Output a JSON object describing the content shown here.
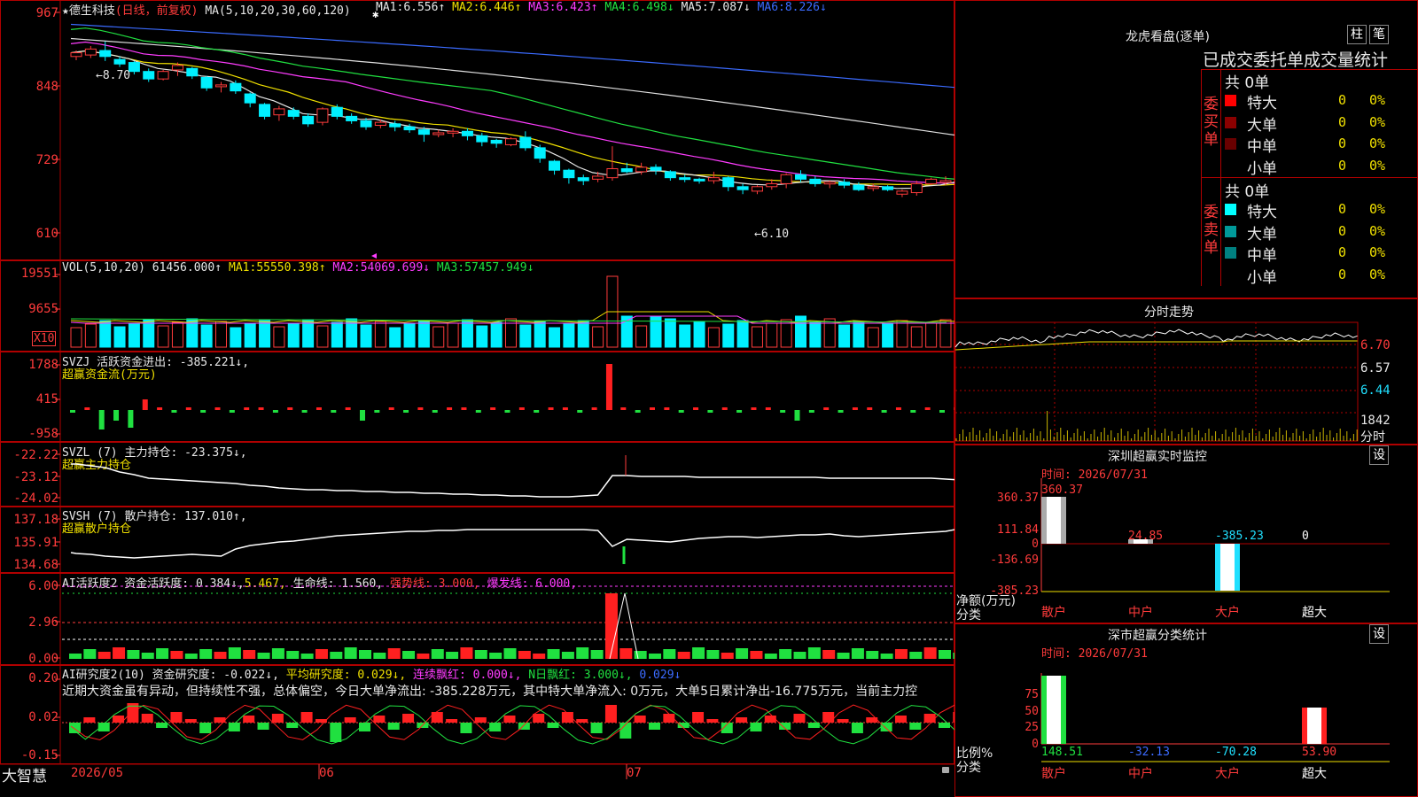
{
  "main": {
    "title": "★德生科技",
    "mode": "(日线，前复权)",
    "ma_header": "MA(5,10,20,30,60,120)",
    "ma": [
      {
        "label": "MA1:",
        "value": "6.556↑",
        "color": "#e8e8e8"
      },
      {
        "label": "MA2:",
        "value": "6.446↑",
        "color": "#f0e000"
      },
      {
        "label": "MA3:",
        "value": "6.423↑",
        "color": "#ff3cff"
      },
      {
        "label": "MA4:",
        "value": "6.498↓",
        "color": "#20e040"
      },
      {
        "label": "MA5:",
        "value": "7.087↓",
        "color": "#e8e8e8"
      },
      {
        "label": "MA6:",
        "value": "8.226↓",
        "color": "#3b6bff"
      }
    ],
    "y_ticks": [
      "967",
      "848",
      "729",
      "610"
    ],
    "high_mark": "8.70",
    "low_mark": "6.10"
  },
  "vol": {
    "header": "VOL(5,10,20)",
    "value": "61456.000↑",
    "ma": [
      {
        "label": "MA1:",
        "value": "55550.398↑",
        "color": "#f0e000"
      },
      {
        "label": "MA2:",
        "value": "54069.699↓",
        "color": "#ff3cff"
      },
      {
        "label": "MA3:",
        "value": "57457.949↓",
        "color": "#20e040"
      }
    ],
    "y_ticks": [
      "19551",
      "9655",
      "X10"
    ]
  },
  "svzj": {
    "header": "SVZJ  活跃资金进出:",
    "value": "-385.221↓,",
    "sub": "超赢资金流(万元)",
    "y_ticks": [
      "1788",
      "415",
      "-958"
    ]
  },
  "svzl": {
    "header": "SVZL (7) 主力持仓:",
    "value": "-23.375↓,",
    "sub": "超赢主力持仓",
    "y_ticks": [
      "-22.22",
      "-23.12",
      "-24.02"
    ]
  },
  "svsh": {
    "header": "SVSH (7) 散户持仓:",
    "value": "137.010↑,",
    "sub": "超赢散户持仓",
    "y_ticks": [
      "137.18",
      "135.91",
      "134.68"
    ]
  },
  "ai1": {
    "header": "AI活跃度2 资金活跃度:",
    "v1": "0.384↓,",
    "v2": "5.467,",
    "life": "生命线: 1.560,",
    "strong": "强势线: 3.000,",
    "burst": "爆发线: 6.000,",
    "y_ticks": [
      "6.00",
      "2.96",
      "0.00"
    ]
  },
  "ai2": {
    "header": "AI研究度2(10) 资金研究度:",
    "v1": "-0.022↓,",
    "avg": "平均研究度: 0.029↓,",
    "streak": "连续飘红: 0.000↓,",
    "nday": "N日飘红: 3.000↓,",
    "v5": "0.029↓",
    "comment": "近期大资金虽有异动，但持续性不强，总体偏空，今日大单净流出: -385.228万元，其中特大单净流入: 0万元，大单5日累计净出-16.775万元，当前主力控",
    "y_ticks": [
      "0.20",
      "0.02",
      "-0.15"
    ]
  },
  "footer": {
    "brand": "大智慧",
    "dates": [
      "2026/05",
      "06",
      "07"
    ]
  },
  "right": {
    "dragon_title": "龙虎看盘(逐单)",
    "btn1": "柱",
    "btn2": "笔",
    "section_title": "已成交委托单成交量统计",
    "buy_label": "委买单",
    "sell_label": "委卖单",
    "buy_total": "共 0单",
    "sell_total": "共 0单",
    "buy_rows": [
      {
        "name": "特大",
        "count": "0",
        "pct": "0%",
        "color": "#ff0000"
      },
      {
        "name": "大单",
        "count": "0",
        "pct": "0%",
        "color": "#8b0000"
      },
      {
        "name": "中单",
        "count": "0",
        "pct": "0%",
        "color": "#6a0000"
      },
      {
        "name": "小单",
        "count": "0",
        "pct": "0%",
        "color": "#000000"
      }
    ],
    "sell_rows": [
      {
        "name": "特大",
        "count": "0",
        "pct": "0%",
        "color": "#00ffff"
      },
      {
        "name": "大单",
        "count": "0",
        "pct": "0%",
        "color": "#009999"
      },
      {
        "name": "中单",
        "count": "0",
        "pct": "0%",
        "color": "#008080"
      },
      {
        "name": "小单",
        "count": "0",
        "pct": "0%",
        "color": "#000000"
      }
    ],
    "intraday_title": "分时走势",
    "intraday_ticks": [
      "6.70",
      "6.57",
      "6.44"
    ],
    "intraday_vol": "1842",
    "intraday_unit": "分时",
    "sz_title": "深圳超赢实时监控",
    "set1": "设",
    "sz_time": "时间: 2026/07/31",
    "sz_ticks": [
      "360.37",
      "111.84",
      "0",
      "-136.69",
      "-385.23"
    ],
    "sz_values": [
      "360.37",
      "24.85",
      "-385.23",
      "0"
    ],
    "sz_ylabel": "净额(万元)",
    "sz_xlabel": "分类",
    "cats": [
      "散户",
      "中户",
      "大户",
      "超大"
    ],
    "sh_title": "深市超赢分类统计",
    "set2": "设",
    "sh_time": "时间: 2026/07/31",
    "sh_ticks": [
      "75",
      "50",
      "25",
      "0"
    ],
    "sh_values": [
      "148.51",
      "-32.13",
      "-70.28",
      "53.90"
    ],
    "sh_ylabel": "比例%",
    "sh_xlabel": "分类"
  },
  "chart_data": {
    "type": "candlestick",
    "candles": [
      [
        8.5,
        8.55,
        8.45,
        8.58
      ],
      [
        8.52,
        8.6,
        8.48,
        8.64
      ],
      [
        8.58,
        8.5,
        8.44,
        8.7
      ],
      [
        8.46,
        8.4,
        8.36,
        8.5
      ],
      [
        8.42,
        8.3,
        8.26,
        8.44
      ],
      [
        8.3,
        8.2,
        8.16,
        8.34
      ],
      [
        8.2,
        8.3,
        8.18,
        8.32
      ],
      [
        8.32,
        8.38,
        8.24,
        8.42
      ],
      [
        8.34,
        8.24,
        8.2,
        8.36
      ],
      [
        8.22,
        8.08,
        8.04,
        8.24
      ],
      [
        8.1,
        8.12,
        8.02,
        8.16
      ],
      [
        8.14,
        8.04,
        8.0,
        8.18
      ],
      [
        8.0,
        7.88,
        7.82,
        8.02
      ],
      [
        7.86,
        7.7,
        7.66,
        7.88
      ],
      [
        7.72,
        7.8,
        7.64,
        7.84
      ],
      [
        7.78,
        7.7,
        7.66,
        7.82
      ],
      [
        7.7,
        7.6,
        7.56,
        7.74
      ],
      [
        7.62,
        7.8,
        7.58,
        7.82
      ],
      [
        7.82,
        7.7,
        7.66,
        7.86
      ],
      [
        7.7,
        7.64,
        7.6,
        7.74
      ],
      [
        7.64,
        7.56,
        7.52,
        7.68
      ],
      [
        7.58,
        7.62,
        7.54,
        7.66
      ],
      [
        7.6,
        7.56,
        7.5,
        7.64
      ],
      [
        7.56,
        7.52,
        7.48,
        7.6
      ],
      [
        7.52,
        7.46,
        7.36,
        7.56
      ],
      [
        7.46,
        7.48,
        7.42,
        7.52
      ],
      [
        7.48,
        7.5,
        7.42,
        7.54
      ],
      [
        7.5,
        7.44,
        7.38,
        7.54
      ],
      [
        7.44,
        7.36,
        7.3,
        7.48
      ],
      [
        7.38,
        7.34,
        7.28,
        7.4
      ],
      [
        7.32,
        7.4,
        7.3,
        7.42
      ],
      [
        7.42,
        7.28,
        7.24,
        7.5
      ],
      [
        7.28,
        7.14,
        7.08,
        7.32
      ],
      [
        7.1,
        6.98,
        6.92,
        7.12
      ],
      [
        6.98,
        6.88,
        6.8,
        7.0
      ],
      [
        6.88,
        6.84,
        6.78,
        6.92
      ],
      [
        6.86,
        6.9,
        6.82,
        6.96
      ],
      [
        6.88,
        7.0,
        6.84,
        7.3
      ],
      [
        7.0,
        6.96,
        6.94,
        7.08
      ],
      [
        6.96,
        7.02,
        6.92,
        7.08
      ],
      [
        7.02,
        6.98,
        6.92,
        7.06
      ],
      [
        6.96,
        6.88,
        6.84,
        6.98
      ],
      [
        6.88,
        6.86,
        6.82,
        6.92
      ],
      [
        6.86,
        6.84,
        6.8,
        6.88
      ],
      [
        6.84,
        6.88,
        6.8,
        6.96
      ],
      [
        6.88,
        6.76,
        6.7,
        6.9
      ],
      [
        6.76,
        6.72,
        6.66,
        6.8
      ],
      [
        6.7,
        6.76,
        6.66,
        6.78
      ],
      [
        6.76,
        6.8,
        6.72,
        6.86
      ],
      [
        6.8,
        6.92,
        6.74,
        6.94
      ],
      [
        6.92,
        6.86,
        6.82,
        6.98
      ],
      [
        6.86,
        6.8,
        6.76,
        6.9
      ],
      [
        6.8,
        6.82,
        6.74,
        6.84
      ],
      [
        6.82,
        6.78,
        6.74,
        6.86
      ],
      [
        6.78,
        6.72,
        6.7,
        6.82
      ],
      [
        6.74,
        6.76,
        6.7,
        6.8
      ],
      [
        6.76,
        6.72,
        6.7,
        6.78
      ],
      [
        6.66,
        6.7,
        6.62,
        6.72
      ],
      [
        6.68,
        6.8,
        6.64,
        6.84
      ],
      [
        6.8,
        6.86,
        6.78,
        6.88
      ],
      [
        6.82,
        6.84,
        6.78,
        6.9
      ],
      [
        6.86,
        6.9,
        6.82,
        6.98
      ],
      [
        6.92,
        6.98,
        6.9,
        7.12
      ]
    ],
    "ma_series": [
      "MA1",
      "MA2",
      "MA3",
      "MA4",
      "MA5",
      "MA6"
    ]
  }
}
